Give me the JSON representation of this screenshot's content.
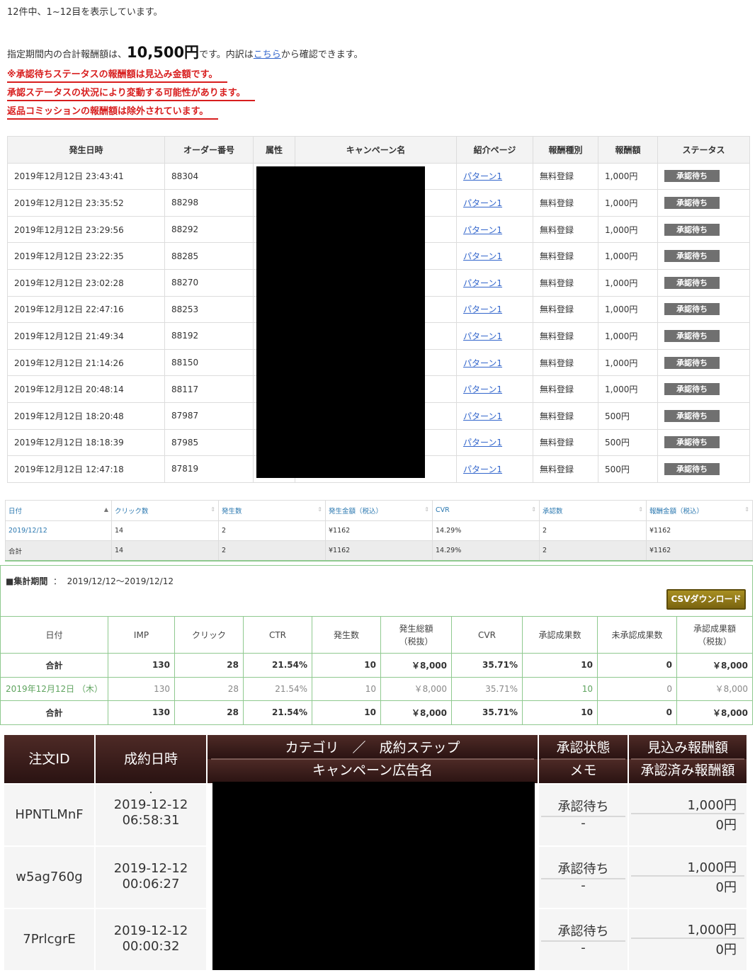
{
  "section1": {
    "count_text": "12件中、1~12目を表示しています。",
    "summary_prefix": "指定期間内の合計報酬額は、",
    "summary_amount": "10,500円",
    "summary_mid": "です。内訳は",
    "summary_link": "こちら",
    "summary_suffix": "から確認できます。",
    "warnings": [
      "※承認待ちステータスの報酬額は見込み金額です。",
      "承認ステータスの状況により変動する可能性があります。",
      "返品コミッションの報酬額は除外されています。"
    ],
    "headers": [
      "発生日時",
      "オーダー番号",
      "属性",
      "キャンペーン名",
      "紹介ページ",
      "報酬種別",
      "報酬額",
      "ステータス"
    ],
    "rows": [
      {
        "datetime": "2019年12月12日 23:43:41",
        "order": "88304",
        "page": "パターン1",
        "type": "無料登録",
        "amount": "1,000円",
        "status": "承認待ち"
      },
      {
        "datetime": "2019年12月12日 23:35:52",
        "order": "88298",
        "page": "パターン1",
        "type": "無料登録",
        "amount": "1,000円",
        "status": "承認待ち"
      },
      {
        "datetime": "2019年12月12日 23:29:56",
        "order": "88292",
        "page": "パターン1",
        "type": "無料登録",
        "amount": "1,000円",
        "status": "承認待ち"
      },
      {
        "datetime": "2019年12月12日 23:22:35",
        "order": "88285",
        "page": "パターン1",
        "type": "無料登録",
        "amount": "1,000円",
        "status": "承認待ち"
      },
      {
        "datetime": "2019年12月12日 23:02:28",
        "order": "88270",
        "page": "パターン1",
        "type": "無料登録",
        "amount": "1,000円",
        "status": "承認待ち"
      },
      {
        "datetime": "2019年12月12日 22:47:16",
        "order": "88253",
        "page": "パターン1",
        "type": "無料登録",
        "amount": "1,000円",
        "status": "承認待ち"
      },
      {
        "datetime": "2019年12月12日 21:49:34",
        "order": "88192",
        "page": "パターン1",
        "type": "無料登録",
        "amount": "1,000円",
        "status": "承認待ち"
      },
      {
        "datetime": "2019年12月12日 21:14:26",
        "order": "88150",
        "page": "パターン1",
        "type": "無料登録",
        "amount": "1,000円",
        "status": "承認待ち"
      },
      {
        "datetime": "2019年12月12日 20:48:14",
        "order": "88117",
        "page": "パターン1",
        "type": "無料登録",
        "amount": "1,000円",
        "status": "承認待ち"
      },
      {
        "datetime": "2019年12月12日 18:20:48",
        "order": "87987",
        "page": "パターン1",
        "type": "無料登録",
        "amount": "500円",
        "status": "承認待ち"
      },
      {
        "datetime": "2019年12月12日 18:18:39",
        "order": "87985",
        "page": "パターン1",
        "type": "無料登録",
        "amount": "500円",
        "status": "承認待ち"
      },
      {
        "datetime": "2019年12月12日 12:47:18",
        "order": "87819",
        "page": "パターン1",
        "type": "無料登録",
        "amount": "500円",
        "status": "承認待ち"
      }
    ]
  },
  "section2": {
    "headers": [
      "日付",
      "クリック数",
      "発生数",
      "発生金額（税込）",
      "CVR",
      "承認数",
      "報酬金額（税込）"
    ],
    "rows": [
      [
        "2019/12/12",
        "14",
        "2",
        "¥1162",
        "14.29%",
        "2",
        "¥1162"
      ],
      [
        "合計",
        "14",
        "2",
        "¥1162",
        "14.29%",
        "2",
        "¥1162"
      ]
    ]
  },
  "section3": {
    "period_label": "■集計期間",
    "period_sep": "：",
    "period_value": "2019/12/12～2019/12/12",
    "csv_button": "CSVダウンロード",
    "headers": [
      "日付",
      "IMP",
      "クリック",
      "CTR",
      "発生数",
      "発生総額",
      "（税抜）",
      "CVR",
      "承認成果数",
      "未承認成果数",
      "承認成果額",
      "（税抜）"
    ],
    "rows": [
      [
        "合計",
        "130",
        "28",
        "21.54%",
        "10",
        "￥8,000",
        "35.71%",
        "10",
        "0",
        "￥8,000"
      ],
      [
        "2019年12月12日 （木）",
        "130",
        "28",
        "21.54%",
        "10",
        "￥8,000",
        "35.71%",
        "10",
        "0",
        "￥8,000"
      ],
      [
        "合計",
        "130",
        "28",
        "21.54%",
        "10",
        "￥8,000",
        "35.71%",
        "10",
        "0",
        "￥8,000"
      ]
    ]
  },
  "section4": {
    "headers": {
      "order_id": "注文ID",
      "date": "成約日時",
      "category_step": "カテゴリ　／　成約ステップ",
      "campaign": "キャンペーン広告名",
      "approval_status": "承認状態",
      "memo": "メモ",
      "expected": "見込み報酬額",
      "approved": "承認済み報酬額"
    },
    "rows": [
      {
        "id": "HPNTLMnF",
        "dot": "・",
        "date": "2019-12-12",
        "time": "06:58:31",
        "status": "承認待ち",
        "memo": "-",
        "expected": "1,000円",
        "approved": "0円"
      },
      {
        "id": "w5ag760g",
        "dot": "",
        "date": "2019-12-12",
        "time": "00:06:27",
        "status": "承認待ち",
        "memo": "-",
        "expected": "1,000円",
        "approved": "0円"
      },
      {
        "id": "7PrlcgrE",
        "dot": "",
        "date": "2019-12-12",
        "time": "00:00:32",
        "status": "承認待ち",
        "memo": "-",
        "expected": "1,000円",
        "approved": "0円"
      }
    ]
  }
}
